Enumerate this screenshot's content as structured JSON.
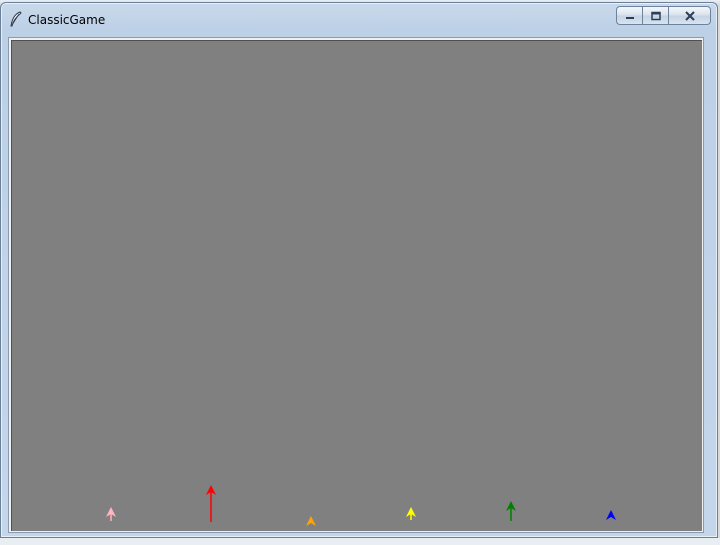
{
  "window": {
    "title": "ClassicGame"
  },
  "colors": {
    "canvas_background": "#808080"
  },
  "turtles": [
    {
      "color": "#ffb6c1"
    },
    {
      "color": "#ff0000"
    },
    {
      "color": "#ffa500"
    },
    {
      "color": "#ffff00"
    },
    {
      "color": "#008000"
    },
    {
      "color": "#0000ff"
    }
  ]
}
